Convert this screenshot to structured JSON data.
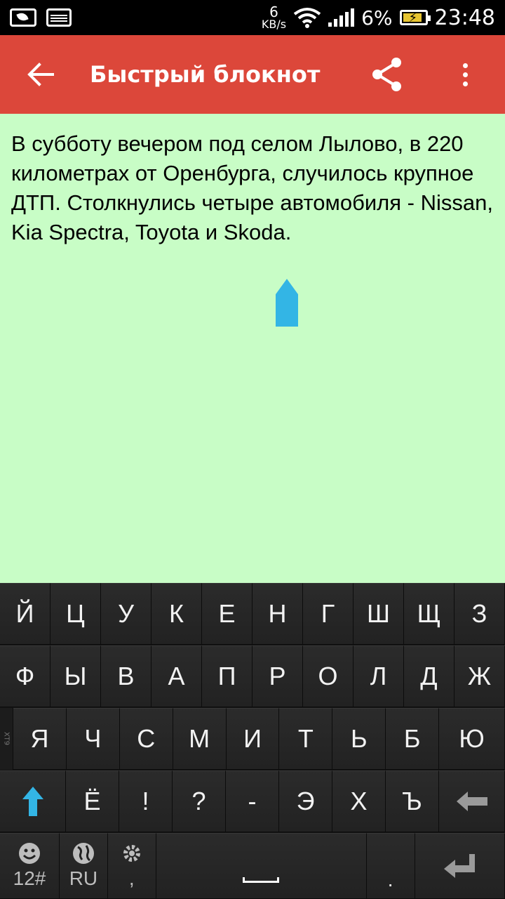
{
  "status_bar": {
    "net_speed_value": "6",
    "net_speed_unit": "KB/s",
    "battery_percent": "6%",
    "time": "23:48"
  },
  "toolbar": {
    "title": "Быстрый блокнот"
  },
  "note": {
    "text": "В субботу вечером под селом Лылово, в 220 километрах от Оренбурга, случилось крупное ДТП. Столкнулись четыре автомобиля - Nissan, Kia Spectra, Toyota и Skoda."
  },
  "keyboard": {
    "row1": [
      "Й",
      "Ц",
      "У",
      "К",
      "Е",
      "Н",
      "Г",
      "Ш",
      "Щ",
      "З"
    ],
    "row2": [
      "Ф",
      "Ы",
      "В",
      "А",
      "П",
      "Р",
      "О",
      "Л",
      "Д",
      "Ж"
    ],
    "row3_side_label": "XT9",
    "row3": [
      "Я",
      "Ч",
      "С",
      "М",
      "И",
      "Т",
      "Ь",
      "Б",
      "Ю"
    ],
    "row4": [
      "Ё",
      "!",
      "?",
      "-",
      "Э",
      "Х",
      "Ъ"
    ],
    "row5": {
      "numbers_label": "12#",
      "language_label": "RU",
      "comma": ",",
      "period": "."
    }
  },
  "colors": {
    "toolbar": "#dc473a",
    "note_background": "#c8fdc6",
    "cursor_handle": "#33b5e5",
    "keyboard": "#141414"
  }
}
